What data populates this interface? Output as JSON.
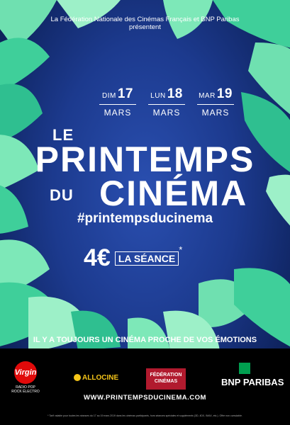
{
  "header": {
    "line1": "La Fédération Nationale des Cinémas Français et BNP Paribas",
    "line2": "présentent"
  },
  "dates": [
    {
      "day": "DIM",
      "num": "17",
      "month": "MARS"
    },
    {
      "day": "LUN",
      "num": "18",
      "month": "MARS"
    },
    {
      "day": "MAR",
      "num": "19",
      "month": "MARS"
    }
  ],
  "title": {
    "le": "LE",
    "main": "PRINTEMPS",
    "du": "DU",
    "cinema": "CINÉMA"
  },
  "hashtag": "#printempsducinema",
  "price": {
    "amount": "4€",
    "label": "LA SÉANCE",
    "asterisk": "*"
  },
  "tagline": "IL Y A TOUJOURS UN CINÉMA PROCHE DE VOS ÉMOTIONS",
  "logos": {
    "virgin": "Virgin",
    "virgin_sub": "RADIO POP ROCK ÉLECTRO",
    "allocine": "ALLOCINE",
    "federation": "FÉDÉRATION CINÉMAS",
    "bnp": "BNP PARIBAS"
  },
  "url": "WWW.PRINTEMPSDUCINEMA.COM",
  "fine_print": "* Tarif valable pour toutes les séances du 17 au 19 mars 2019 dans les cinémas participants, hors séances spéciales et suppléments (3D, 4DX, IMAX, etc.). Offre non cumulable.",
  "colors": {
    "background": "#1c3a8e",
    "leaf_light": "#7de8b8",
    "leaf_mid": "#3fcf9a",
    "leaf_dark": "#1fa882",
    "text": "#ffffff"
  }
}
